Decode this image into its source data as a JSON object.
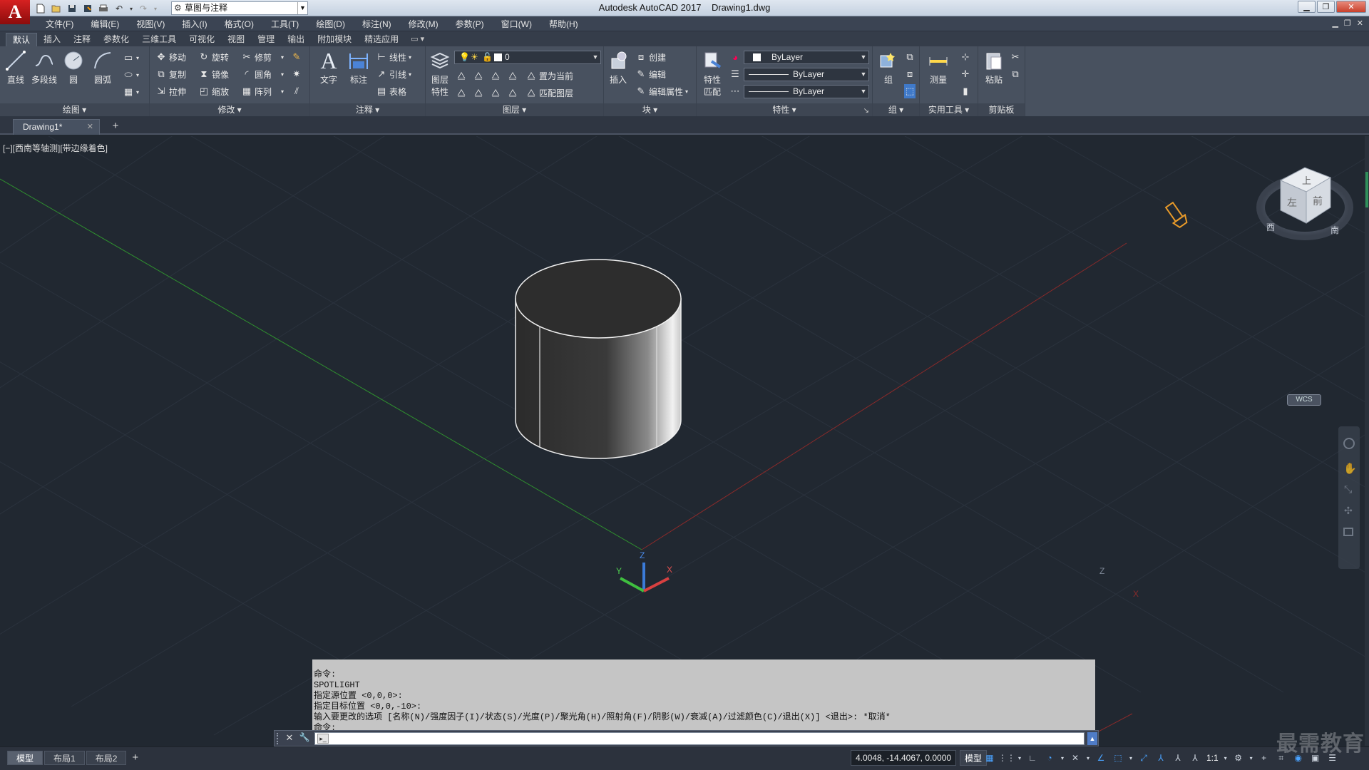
{
  "app": {
    "logo": "A",
    "title": "Autodesk AutoCAD 2017    Drawing1.dwg",
    "workspace": "草图与注释"
  },
  "menu": [
    "文件(F)",
    "编辑(E)",
    "视图(V)",
    "插入(I)",
    "格式(O)",
    "工具(T)",
    "绘图(D)",
    "标注(N)",
    "修改(M)",
    "参数(P)",
    "窗口(W)",
    "帮助(H)"
  ],
  "ribbon_tabs": [
    "默认",
    "插入",
    "注释",
    "参数化",
    "三维工具",
    "可视化",
    "视图",
    "管理",
    "输出",
    "附加模块",
    "精选应用"
  ],
  "ribbon_tabs_extra": "▭ ▾",
  "ribbon": {
    "draw": {
      "title": "绘图 ▾",
      "line": "直线",
      "polyline": "多段线",
      "circle": "圆",
      "arc": "圆弧"
    },
    "modify": {
      "title": "修改 ▾",
      "move": "移动",
      "rotate": "旋转",
      "trim": "修剪",
      "copy": "复制",
      "mirror": "镜像",
      "fillet": "圆角",
      "stretch": "拉伸",
      "scale": "缩放",
      "array": "阵列"
    },
    "annotation": {
      "title": "注释 ▾",
      "text": "文字",
      "dimension": "标注",
      "linear": "线性",
      "leader": "引线",
      "table": "表格"
    },
    "layers": {
      "title": "图层 ▾",
      "properties_line1": "图层",
      "properties_line2": "特性",
      "current_layer": "0",
      "set_current": "置为当前",
      "match_layer": "匹配图层"
    },
    "block": {
      "title": "块 ▾",
      "insert": "插入",
      "create": "创建",
      "edit": "编辑",
      "edit_attributes": "编辑属性"
    },
    "properties": {
      "title": "特性 ▾",
      "match_line1": "特性",
      "match_line2": "匹配",
      "color": "ByLayer",
      "lineweight": "ByLayer",
      "linetype": "ByLayer"
    },
    "groups": {
      "title": "组 ▾",
      "group": "组"
    },
    "utilities": {
      "title": "实用工具 ▾",
      "measure": "测量"
    },
    "clipboard": {
      "title": "剪贴板",
      "paste": "粘贴"
    }
  },
  "filetab": {
    "name": "Drawing1*",
    "close": "✕",
    "new": "+"
  },
  "viewport": {
    "label": "[−][西南等轴测][带边缘着色]",
    "viewcube_top": "上",
    "viewcube_left": "左",
    "viewcube_front": "前",
    "compass_w": "西",
    "compass_s": "南",
    "wcs": "WCS",
    "ucs_z": "Z",
    "ucs_x": "X",
    "ucs_y": "Y",
    "corner_z": "Z",
    "corner_x": "X"
  },
  "command": {
    "history": [
      "命令:",
      "SPOTLIGHT",
      "指定源位置 <0,0,0>:",
      "指定目标位置 <0,0,-10>:",
      "输入要更改的选项 [名称(N)/强度因子(I)/状态(S)/光度(P)/聚光角(H)/照射角(F)/阴影(W)/衰减(A)/过滤颜色(C)/退出(X)] <退出>: *取消*",
      "命令:"
    ],
    "input": "",
    "prompt_icon": "▸_"
  },
  "status": {
    "layouts": [
      "模型",
      "布局1",
      "布局2"
    ],
    "coords": "4.0048, -14.4067, 0.0000",
    "model": "模型",
    "scale": "1:1"
  },
  "watermark": "最需教育"
}
